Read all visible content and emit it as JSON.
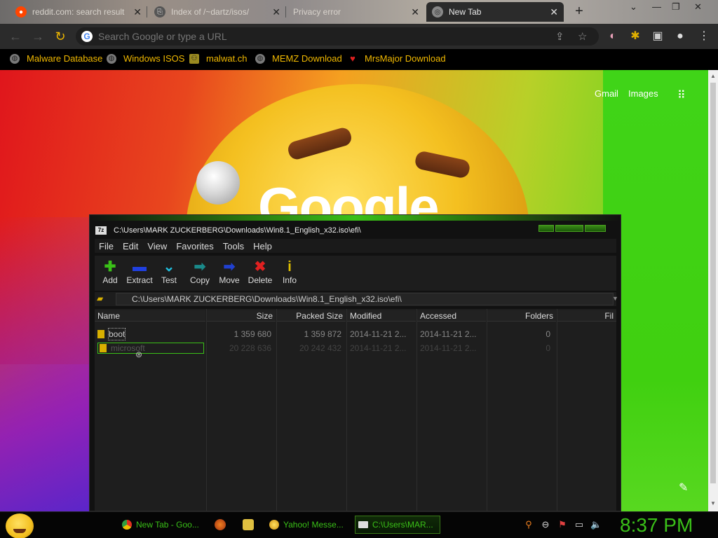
{
  "browser": {
    "tabs": [
      {
        "label": "reddit.com: search result",
        "icon": "reddit-icon",
        "icon_color": "#ff4500"
      },
      {
        "label": "Index of /~dartz/isos/",
        "icon": "index-icon",
        "icon_color": "#555555"
      },
      {
        "label": "Privacy error",
        "icon": "warning-icon",
        "icon_color": "#777777"
      },
      {
        "label": "New Tab",
        "icon": "chrome-icon",
        "icon_color": "#888888",
        "active": true
      }
    ],
    "new_tab": "+",
    "omnibox_placeholder": "Search Google or type a URL",
    "bookmarks": [
      {
        "label": "Malware Database",
        "icon": "globe-icon"
      },
      {
        "label": "Windows ISOS",
        "icon": "globe-icon"
      },
      {
        "label": "malwat.ch",
        "icon": "person-icon"
      },
      {
        "label": "MEMZ Download",
        "icon": "globe-icon"
      },
      {
        "label": "MrsMajor Download",
        "icon": "heart-icon"
      }
    ],
    "accent": "#f0b800"
  },
  "newtab_page": {
    "logo_text": "Google",
    "links": [
      "Gmail",
      "Images"
    ]
  },
  "zip": {
    "title": "C:\\Users\\MARK ZUCKERBERG\\Downloads\\Win8.1_English_x32.iso\\efi\\",
    "menu": [
      "File",
      "Edit",
      "View",
      "Favorites",
      "Tools",
      "Help"
    ],
    "tools": [
      {
        "label": "Add",
        "icon": "plus-icon",
        "symbol": "✚",
        "color": "#3ac018"
      },
      {
        "label": "Extract",
        "icon": "minus-icon",
        "symbol": "▬",
        "color": "#2040e0"
      },
      {
        "label": "Test",
        "icon": "check-icon",
        "symbol": "⌄",
        "color": "#20c0e0"
      },
      {
        "label": "Copy",
        "icon": "copy-icon",
        "symbol": "➡",
        "color": "#1a8a8a"
      },
      {
        "label": "Move",
        "icon": "move-icon",
        "symbol": "➡",
        "color": "#2040d0"
      },
      {
        "label": "Delete",
        "icon": "delete-icon",
        "symbol": "✖",
        "color": "#e02020"
      },
      {
        "label": "Info",
        "icon": "info-icon",
        "symbol": "i",
        "color": "#e0c000"
      }
    ],
    "path": "C:\\Users\\MARK ZUCKERBERG\\Downloads\\Win8.1_English_x32.iso\\efi\\",
    "columns": [
      "Name",
      "Size",
      "Packed Size",
      "Modified",
      "Accessed",
      "Folders",
      "Fil"
    ],
    "rows": [
      {
        "name": "boot",
        "size": "1 359 680",
        "packed": "1 359 872",
        "modified": "2014-11-21 2...",
        "accessed": "2014-11-21 2...",
        "folders": "0"
      },
      {
        "name": "microsoft",
        "size": "20 228 636",
        "packed": "20 242 432",
        "modified": "2014-11-21 2...",
        "accessed": "2014-11-21 2...",
        "folders": "0"
      }
    ]
  },
  "taskbar": {
    "tasks": [
      {
        "label": "New Tab - Goo...",
        "icon": "chrome-icon"
      },
      {
        "label": "Yahoo! Messe...",
        "icon": "yahoo-messenger-icon"
      },
      {
        "label": "C:\\Users\\MAR...",
        "icon": "sevenzip-icon",
        "active": true
      }
    ],
    "clock": "8:37 PM",
    "clock_color": "#3ac018"
  }
}
